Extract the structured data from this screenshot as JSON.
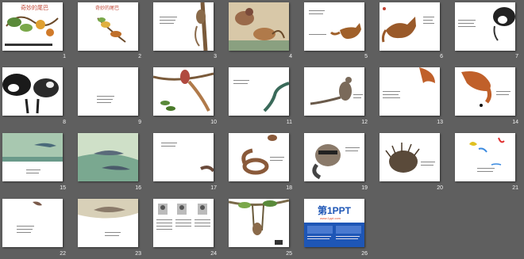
{
  "slides": [
    {
      "num": "1"
    },
    {
      "num": "2"
    },
    {
      "num": "3"
    },
    {
      "num": "4"
    },
    {
      "num": "5"
    },
    {
      "num": "6"
    },
    {
      "num": "7"
    },
    {
      "num": "8"
    },
    {
      "num": "9"
    },
    {
      "num": "10"
    },
    {
      "num": "11"
    },
    {
      "num": "12"
    },
    {
      "num": "13"
    },
    {
      "num": "14"
    },
    {
      "num": "15"
    },
    {
      "num": "16"
    },
    {
      "num": "17"
    },
    {
      "num": "18"
    },
    {
      "num": "19"
    },
    {
      "num": "20"
    },
    {
      "num": "21"
    },
    {
      "num": "22"
    },
    {
      "num": "23"
    },
    {
      "num": "24"
    },
    {
      "num": "25"
    },
    {
      "num": "26"
    }
  ],
  "book_title": "奇妙的尾巴",
  "ppt_logo": "第1PPT",
  "ppt_site": "www.1ppt.com",
  "colors": {
    "background": "#5f5f5f",
    "slide": "#ffffff",
    "accent": "#1e56b6"
  }
}
